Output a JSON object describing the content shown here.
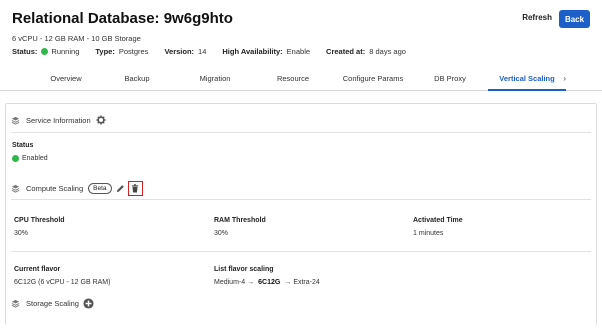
{
  "header": {
    "title": "Relational Database: 9w6g9hto",
    "specs": "6 vCPU - 12 GB RAM - 10 GB Storage",
    "refresh_label": "Refresh",
    "back_label": "Back",
    "status_label": "Status:",
    "status_value": "Running",
    "type_label": "Type:",
    "type_value": "Postgres",
    "version_label": "Version:",
    "version_value": "14",
    "ha_label": "High Availability:",
    "ha_value": "Enable",
    "created_label": "Created at:",
    "created_value": "8 days ago"
  },
  "tabs": [
    {
      "label": "Overview"
    },
    {
      "label": "Backup"
    },
    {
      "label": "Migration"
    },
    {
      "label": "Resource"
    },
    {
      "label": "Configure Params"
    },
    {
      "label": "DB Proxy"
    },
    {
      "label": "Vertical Scaling"
    }
  ],
  "tab_arrow": "›",
  "service_info": {
    "title": "Service Information",
    "status_label": "Status",
    "status_value": "Enabled"
  },
  "compute_scaling": {
    "title": "Compute Scaling",
    "badge": "Beta",
    "cpu_label": "CPU Threshold",
    "cpu_value": "30%",
    "ram_label": "RAM Threshold",
    "ram_value": "30%",
    "activated_label": "Activated Time",
    "activated_value": "1 minutes",
    "current_flavor_label": "Current flavor",
    "current_flavor_value": "6C12G (6 vCPU - 12 GB RAM)",
    "list_flavor_label": "List flavor scaling",
    "list_flavor_from": "Medium-4",
    "list_flavor_current": "6C12G",
    "list_flavor_to": "Extra-24",
    "arrow": "→"
  },
  "storage_scaling": {
    "title": "Storage Scaling"
  },
  "colors": {
    "accent": "#1c5fc9",
    "status_green": "#2db84b",
    "highlight_red": "#d32020"
  }
}
